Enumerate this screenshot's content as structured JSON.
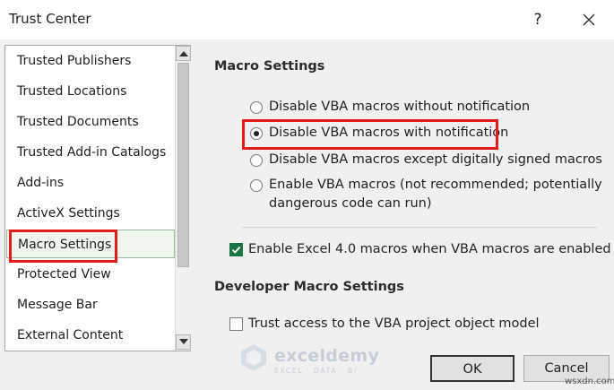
{
  "window": {
    "title": "Trust Center",
    "help_label": "?",
    "close_icon": "close-icon"
  },
  "sidebar": {
    "items": [
      {
        "label": "Trusted Publishers"
      },
      {
        "label": "Trusted Locations"
      },
      {
        "label": "Trusted Documents"
      },
      {
        "label": "Trusted Add-in Catalogs"
      },
      {
        "label": "Add-ins"
      },
      {
        "label": "ActiveX Settings"
      },
      {
        "label": "Macro Settings",
        "selected": true
      },
      {
        "label": "Protected View"
      },
      {
        "label": "Message Bar"
      },
      {
        "label": "External Content"
      }
    ],
    "scroll_up_icon": "arrow-up-icon",
    "scroll_down_icon": "arrow-down-icon"
  },
  "macro_settings": {
    "heading": "Macro Settings",
    "options": [
      {
        "label": "Disable VBA macros without notification",
        "checked": false
      },
      {
        "label": "Disable VBA macros with notification",
        "checked": true
      },
      {
        "label": "Disable VBA macros except digitally signed macros",
        "checked": false
      },
      {
        "label_line1": "Enable VBA macros (not recommended; potentially",
        "label_line2": "dangerous code can run)",
        "checked": false
      }
    ],
    "excel4": {
      "label": "Enable Excel 4.0 macros when VBA macros are enabled",
      "checked": true
    }
  },
  "developer_settings": {
    "heading": "Developer Macro Settings",
    "trust_vba": {
      "label": "Trust access to the VBA project object model",
      "checked": false
    }
  },
  "buttons": {
    "ok": "OK",
    "cancel": "Cancel"
  },
  "watermark": {
    "name": "exceldemy",
    "tagline": "EXCEL · DATA · BI"
  },
  "site": "wsxdn.com",
  "colors": {
    "highlight": "#e31b1b",
    "checkbox_on": "#1a7343"
  }
}
